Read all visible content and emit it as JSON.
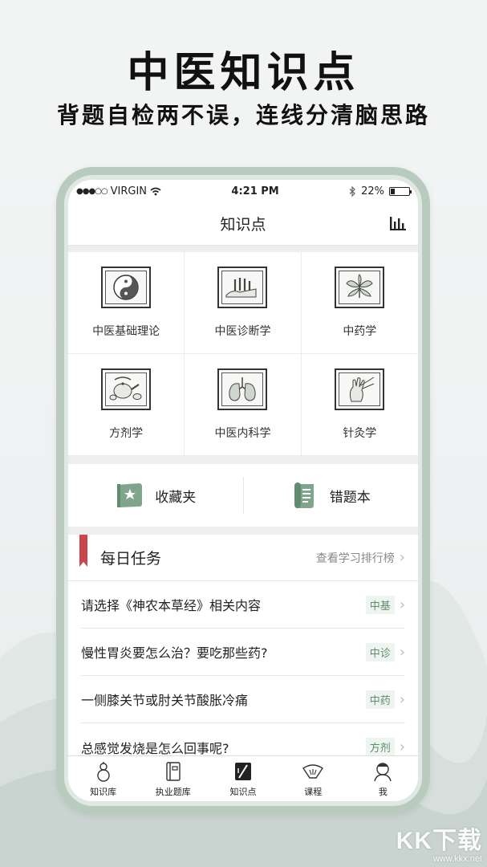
{
  "headline": "中医知识点",
  "subline": "背题自检两不误，连线分清脑思路",
  "status": {
    "carrier": "VIRGIN",
    "time": "4:21 PM",
    "battery": "22%"
  },
  "nav": {
    "title": "知识点"
  },
  "categories": [
    {
      "label": "中医基础理论",
      "icon": "yin-yang-icon"
    },
    {
      "label": "中医诊断学",
      "icon": "pulse-hand-icon"
    },
    {
      "label": "中药学",
      "icon": "herb-leaf-icon"
    },
    {
      "label": "方剂学",
      "icon": "teapot-icon"
    },
    {
      "label": "中医内科学",
      "icon": "lungs-icon"
    },
    {
      "label": "针灸学",
      "icon": "acupuncture-hand-icon"
    }
  ],
  "quick": {
    "favorites": "收藏夹",
    "mistakes": "错题本"
  },
  "tasks": {
    "title": "每日任务",
    "rank_link": "查看学习排行榜",
    "items": [
      {
        "question": "请选择《神农本草经》相关内容",
        "tag": "中基"
      },
      {
        "question": "慢性胃炎要怎么治？要吃那些药?",
        "tag": "中诊"
      },
      {
        "question": "一侧膝关节或肘关节酸胀冷痛",
        "tag": "中药"
      },
      {
        "question": "总感觉发烧是怎么回事呢?",
        "tag": "方剂"
      }
    ]
  },
  "tabs": [
    {
      "label": "知识库"
    },
    {
      "label": "执业题库"
    },
    {
      "label": "知识点"
    },
    {
      "label": "课程"
    },
    {
      "label": "我"
    }
  ],
  "watermark": {
    "logo": "KK下载",
    "url": "www.kkx.net"
  },
  "colors": {
    "accent_green": "#5f8c6f",
    "ribbon_red": "#c8474c",
    "phone_frame": "#b9cbbf"
  }
}
